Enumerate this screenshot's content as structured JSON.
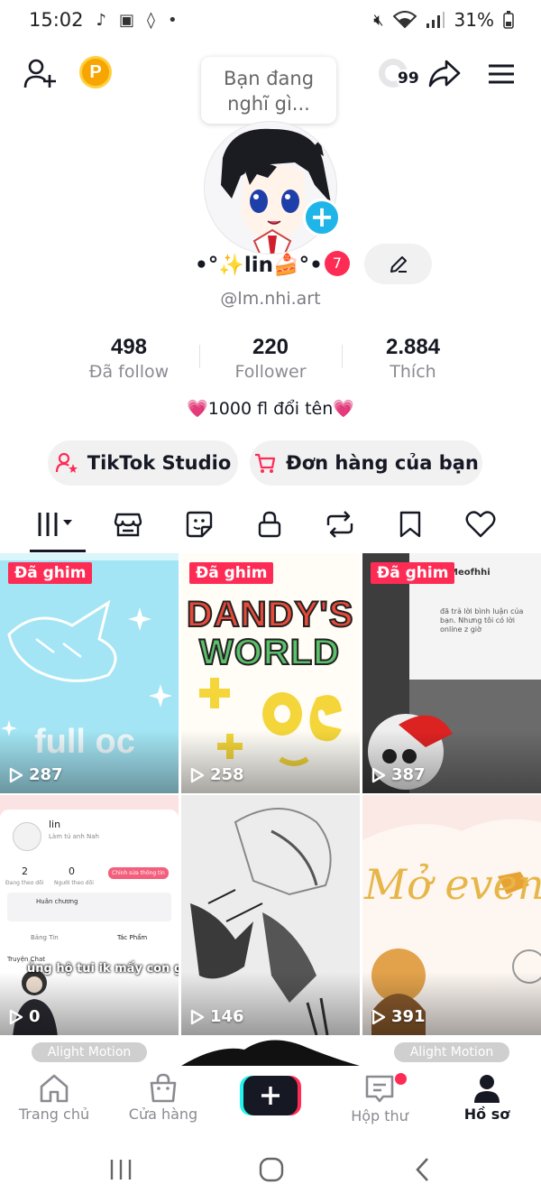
{
  "status_bar": {
    "time": "15:02",
    "battery": "31%"
  },
  "header": {
    "coin_label": "P",
    "notifications_count": "99"
  },
  "note_bubble": {
    "line1": "Bạn đang",
    "line2": "nghĩ gì..."
  },
  "profile": {
    "nickname": "•°✨lin🍰°•",
    "name_badge": "7",
    "username": "@lm.nhi.art",
    "bio": "💗1000 fl đổi tên💗"
  },
  "stats": [
    {
      "value": "498",
      "label": "Đã follow"
    },
    {
      "value": "220",
      "label": "Follower"
    },
    {
      "value": "2.884",
      "label": "Thích"
    }
  ],
  "actions": {
    "studio_label": "TikTok Studio",
    "orders_label": "Đơn hàng của bạn"
  },
  "videos": [
    {
      "pinned": "Đã ghim",
      "views": "287",
      "caption": "full oc"
    },
    {
      "pinned": "Đã ghim",
      "views": "258",
      "title_line1": "DANDY'S",
      "title_line2": "WORLD"
    },
    {
      "pinned": "Đã ghim",
      "views": "387",
      "thumb_user": "Meofhhi",
      "thumb_text": "đã trả lời bình luận của bạn. Nhưng tôi có lời online z giờ"
    },
    {
      "views": "0",
      "thumb_name": "lin",
      "thumb_sub": "Làm tú anh Nah",
      "thumb_stat1": "2",
      "thumb_stat1_label": "Đang theo dõi",
      "thumb_stat2": "0",
      "thumb_stat2_label": "Người theo dõi",
      "thumb_btn": "Chỉnh sửa thông tin",
      "thumb_badge": "Huân chương",
      "thumb_tab1": "Bảng Tin",
      "thumb_tab2": "Tác Phẩm",
      "thumb_chat": "Truyện Chat",
      "caption": "ủng hộ tui ik mấy con ghệ"
    },
    {
      "views": "146"
    },
    {
      "views": "391",
      "caption": "Mở even"
    }
  ],
  "strip_badges": [
    "Alight Motion",
    "Alight Motion"
  ],
  "bottom_nav": [
    {
      "label": "Trang chủ"
    },
    {
      "label": "Cửa hàng"
    },
    {
      "label": "Hộp thư"
    },
    {
      "label": "Hồ sơ"
    }
  ],
  "colors": {
    "accent": "#fe2c55",
    "plus": "#20b5e9",
    "coin": "#f7a500"
  }
}
